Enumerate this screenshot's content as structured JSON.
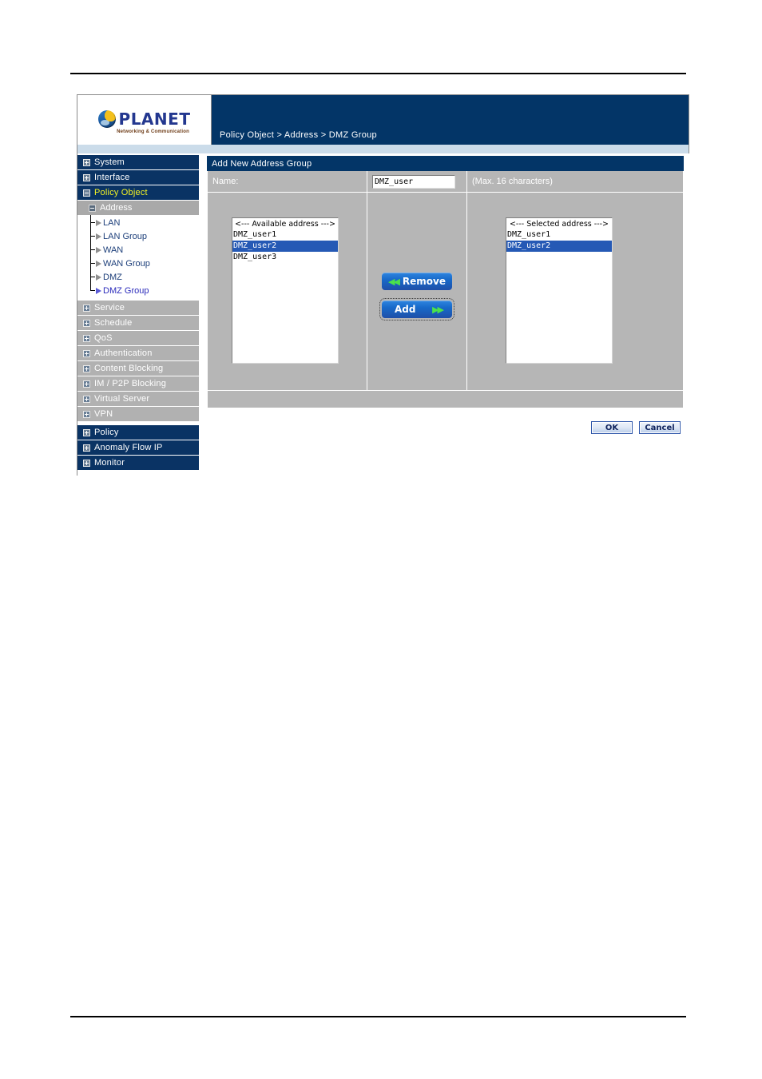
{
  "breadcrumb": "Policy Object > Address > DMZ Group",
  "logo": {
    "word": "PLANET",
    "tagline": "Networking & Communication"
  },
  "sidebar": {
    "top_items": [
      {
        "label": "System",
        "state": "collapsed"
      },
      {
        "label": "Interface",
        "state": "collapsed"
      },
      {
        "label": "Policy Object",
        "state": "expanded"
      }
    ],
    "section": {
      "label": "Address",
      "state": "expanded"
    },
    "tree_items": [
      {
        "label": "LAN"
      },
      {
        "label": "LAN Group"
      },
      {
        "label": "WAN"
      },
      {
        "label": "WAN Group"
      },
      {
        "label": "DMZ"
      },
      {
        "label": "DMZ Group"
      }
    ],
    "gray_items": [
      {
        "label": "Service"
      },
      {
        "label": "Schedule"
      },
      {
        "label": "QoS"
      },
      {
        "label": "Authentication"
      },
      {
        "label": "Content Blocking"
      },
      {
        "label": "IM / P2P Blocking"
      },
      {
        "label": "Virtual Server"
      },
      {
        "label": "VPN"
      }
    ],
    "bottom_items": [
      {
        "label": "Policy"
      },
      {
        "label": "Anomaly Flow IP"
      },
      {
        "label": "Monitor"
      }
    ]
  },
  "panel": {
    "title": "Add New Address Group",
    "name_label": "Name:",
    "name_value": "DMZ_user",
    "name_hint": "(Max. 16 characters)"
  },
  "available": {
    "header": "<--- Available address --->",
    "options": [
      {
        "label": "DMZ_user1",
        "selected": false
      },
      {
        "label": "DMZ_user2",
        "selected": true
      },
      {
        "label": "DMZ_user3",
        "selected": false
      }
    ]
  },
  "selected": {
    "header": "<--- Selected address --->",
    "options": [
      {
        "label": "DMZ_user1",
        "selected": false
      },
      {
        "label": "DMZ_user2",
        "selected": true
      }
    ]
  },
  "transfer_buttons": {
    "remove_label": "Remove",
    "add_label": "Add",
    "left_chevrons": "◀◀",
    "right_chevrons": "▶▶"
  },
  "actions": {
    "ok_label": "OK",
    "cancel_label": "Cancel"
  },
  "colors": {
    "header_blue": "#033567",
    "nav_blue": "#0a3364",
    "nav_gray": "#b1b1b1",
    "panel_gray": "#b6b6b6",
    "highlight_blue": "#2559b5",
    "active_yellow": "#f2f224",
    "strip_blue": "#cbdcea"
  }
}
